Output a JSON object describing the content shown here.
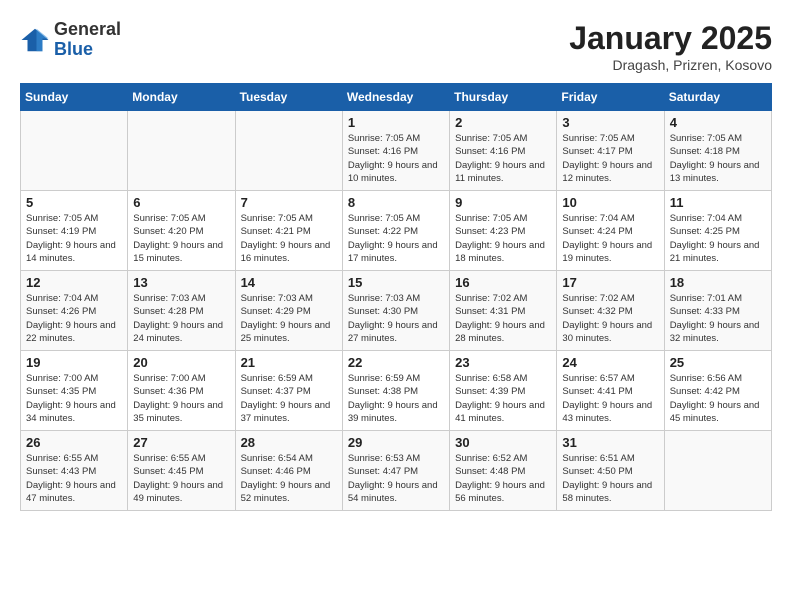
{
  "logo": {
    "general": "General",
    "blue": "Blue"
  },
  "title": "January 2025",
  "subtitle": "Dragash, Prizren, Kosovo",
  "days_of_week": [
    "Sunday",
    "Monday",
    "Tuesday",
    "Wednesday",
    "Thursday",
    "Friday",
    "Saturday"
  ],
  "weeks": [
    [
      {
        "day": "",
        "sunrise": "",
        "sunset": "",
        "daylight": ""
      },
      {
        "day": "",
        "sunrise": "",
        "sunset": "",
        "daylight": ""
      },
      {
        "day": "",
        "sunrise": "",
        "sunset": "",
        "daylight": ""
      },
      {
        "day": "1",
        "sunrise": "Sunrise: 7:05 AM",
        "sunset": "Sunset: 4:16 PM",
        "daylight": "Daylight: 9 hours and 10 minutes."
      },
      {
        "day": "2",
        "sunrise": "Sunrise: 7:05 AM",
        "sunset": "Sunset: 4:16 PM",
        "daylight": "Daylight: 9 hours and 11 minutes."
      },
      {
        "day": "3",
        "sunrise": "Sunrise: 7:05 AM",
        "sunset": "Sunset: 4:17 PM",
        "daylight": "Daylight: 9 hours and 12 minutes."
      },
      {
        "day": "4",
        "sunrise": "Sunrise: 7:05 AM",
        "sunset": "Sunset: 4:18 PM",
        "daylight": "Daylight: 9 hours and 13 minutes."
      }
    ],
    [
      {
        "day": "5",
        "sunrise": "Sunrise: 7:05 AM",
        "sunset": "Sunset: 4:19 PM",
        "daylight": "Daylight: 9 hours and 14 minutes."
      },
      {
        "day": "6",
        "sunrise": "Sunrise: 7:05 AM",
        "sunset": "Sunset: 4:20 PM",
        "daylight": "Daylight: 9 hours and 15 minutes."
      },
      {
        "day": "7",
        "sunrise": "Sunrise: 7:05 AM",
        "sunset": "Sunset: 4:21 PM",
        "daylight": "Daylight: 9 hours and 16 minutes."
      },
      {
        "day": "8",
        "sunrise": "Sunrise: 7:05 AM",
        "sunset": "Sunset: 4:22 PM",
        "daylight": "Daylight: 9 hours and 17 minutes."
      },
      {
        "day": "9",
        "sunrise": "Sunrise: 7:05 AM",
        "sunset": "Sunset: 4:23 PM",
        "daylight": "Daylight: 9 hours and 18 minutes."
      },
      {
        "day": "10",
        "sunrise": "Sunrise: 7:04 AM",
        "sunset": "Sunset: 4:24 PM",
        "daylight": "Daylight: 9 hours and 19 minutes."
      },
      {
        "day": "11",
        "sunrise": "Sunrise: 7:04 AM",
        "sunset": "Sunset: 4:25 PM",
        "daylight": "Daylight: 9 hours and 21 minutes."
      }
    ],
    [
      {
        "day": "12",
        "sunrise": "Sunrise: 7:04 AM",
        "sunset": "Sunset: 4:26 PM",
        "daylight": "Daylight: 9 hours and 22 minutes."
      },
      {
        "day": "13",
        "sunrise": "Sunrise: 7:03 AM",
        "sunset": "Sunset: 4:28 PM",
        "daylight": "Daylight: 9 hours and 24 minutes."
      },
      {
        "day": "14",
        "sunrise": "Sunrise: 7:03 AM",
        "sunset": "Sunset: 4:29 PM",
        "daylight": "Daylight: 9 hours and 25 minutes."
      },
      {
        "day": "15",
        "sunrise": "Sunrise: 7:03 AM",
        "sunset": "Sunset: 4:30 PM",
        "daylight": "Daylight: 9 hours and 27 minutes."
      },
      {
        "day": "16",
        "sunrise": "Sunrise: 7:02 AM",
        "sunset": "Sunset: 4:31 PM",
        "daylight": "Daylight: 9 hours and 28 minutes."
      },
      {
        "day": "17",
        "sunrise": "Sunrise: 7:02 AM",
        "sunset": "Sunset: 4:32 PM",
        "daylight": "Daylight: 9 hours and 30 minutes."
      },
      {
        "day": "18",
        "sunrise": "Sunrise: 7:01 AM",
        "sunset": "Sunset: 4:33 PM",
        "daylight": "Daylight: 9 hours and 32 minutes."
      }
    ],
    [
      {
        "day": "19",
        "sunrise": "Sunrise: 7:00 AM",
        "sunset": "Sunset: 4:35 PM",
        "daylight": "Daylight: 9 hours and 34 minutes."
      },
      {
        "day": "20",
        "sunrise": "Sunrise: 7:00 AM",
        "sunset": "Sunset: 4:36 PM",
        "daylight": "Daylight: 9 hours and 35 minutes."
      },
      {
        "day": "21",
        "sunrise": "Sunrise: 6:59 AM",
        "sunset": "Sunset: 4:37 PM",
        "daylight": "Daylight: 9 hours and 37 minutes."
      },
      {
        "day": "22",
        "sunrise": "Sunrise: 6:59 AM",
        "sunset": "Sunset: 4:38 PM",
        "daylight": "Daylight: 9 hours and 39 minutes."
      },
      {
        "day": "23",
        "sunrise": "Sunrise: 6:58 AM",
        "sunset": "Sunset: 4:39 PM",
        "daylight": "Daylight: 9 hours and 41 minutes."
      },
      {
        "day": "24",
        "sunrise": "Sunrise: 6:57 AM",
        "sunset": "Sunset: 4:41 PM",
        "daylight": "Daylight: 9 hours and 43 minutes."
      },
      {
        "day": "25",
        "sunrise": "Sunrise: 6:56 AM",
        "sunset": "Sunset: 4:42 PM",
        "daylight": "Daylight: 9 hours and 45 minutes."
      }
    ],
    [
      {
        "day": "26",
        "sunrise": "Sunrise: 6:55 AM",
        "sunset": "Sunset: 4:43 PM",
        "daylight": "Daylight: 9 hours and 47 minutes."
      },
      {
        "day": "27",
        "sunrise": "Sunrise: 6:55 AM",
        "sunset": "Sunset: 4:45 PM",
        "daylight": "Daylight: 9 hours and 49 minutes."
      },
      {
        "day": "28",
        "sunrise": "Sunrise: 6:54 AM",
        "sunset": "Sunset: 4:46 PM",
        "daylight": "Daylight: 9 hours and 52 minutes."
      },
      {
        "day": "29",
        "sunrise": "Sunrise: 6:53 AM",
        "sunset": "Sunset: 4:47 PM",
        "daylight": "Daylight: 9 hours and 54 minutes."
      },
      {
        "day": "30",
        "sunrise": "Sunrise: 6:52 AM",
        "sunset": "Sunset: 4:48 PM",
        "daylight": "Daylight: 9 hours and 56 minutes."
      },
      {
        "day": "31",
        "sunrise": "Sunrise: 6:51 AM",
        "sunset": "Sunset: 4:50 PM",
        "daylight": "Daylight: 9 hours and 58 minutes."
      },
      {
        "day": "",
        "sunrise": "",
        "sunset": "",
        "daylight": ""
      }
    ]
  ]
}
